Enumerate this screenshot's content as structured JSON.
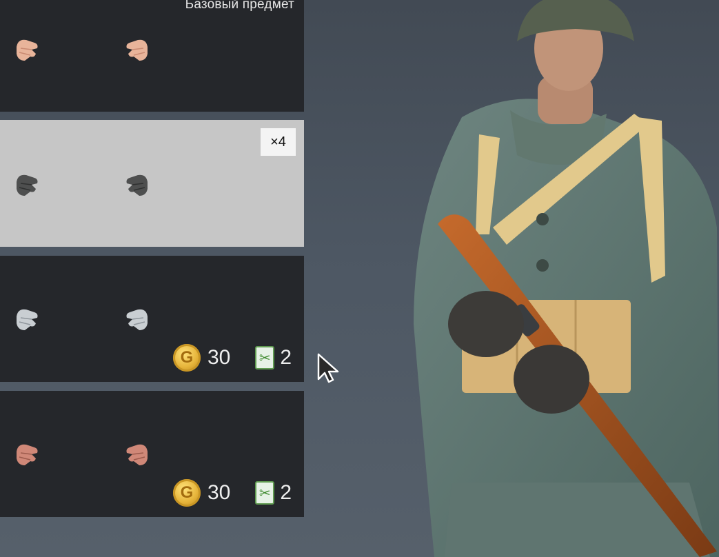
{
  "inventory": {
    "cards": [
      {
        "title": "Базовый предмет",
        "glove_color": "#e8b49a",
        "glove_shade": "#c98a72"
      },
      {
        "quantity": "×4",
        "glove_color": "#4e4f4f",
        "glove_shade": "#2f3030",
        "selected": true
      },
      {
        "glove_color": "#c9ced2",
        "glove_shade": "#8f969c",
        "price": {
          "gold": "30",
          "tickets": "2"
        }
      },
      {
        "glove_color": "#d08878",
        "glove_shade": "#9c5a4c",
        "price": {
          "gold": "30",
          "tickets": "2"
        }
      }
    ],
    "coin_letter": "G",
    "colors": {
      "card_bg": "#25272b",
      "card_selected_bg": "#c6c6c6",
      "background": "#4d5763"
    }
  }
}
